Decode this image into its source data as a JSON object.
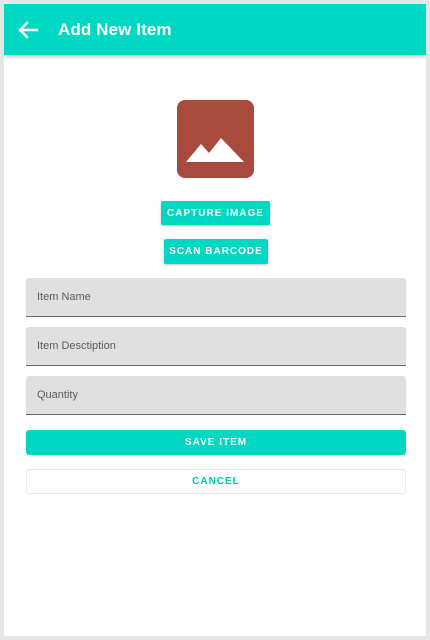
{
  "colors": {
    "primary": "#00d8c4",
    "image_placeholder": "#a94a3f",
    "placeholder_mountain": "#ffffff",
    "cancel_text": "#00c2b0"
  },
  "appbar": {
    "back_icon": "arrow-left-icon",
    "title": "Add New Item"
  },
  "image": {
    "icon": "image-icon"
  },
  "buttons": {
    "capture_label": "CAPTURE IMAGE",
    "scan_label": "SCAN BARCODE",
    "save_label": "SAVE ITEM",
    "cancel_label": "CANCEL"
  },
  "form": {
    "name_placeholder": "Item Name",
    "name_value": "",
    "description_placeholder": "Item Desctiption",
    "description_value": "",
    "quantity_placeholder": "Quantity",
    "quantity_value": ""
  }
}
